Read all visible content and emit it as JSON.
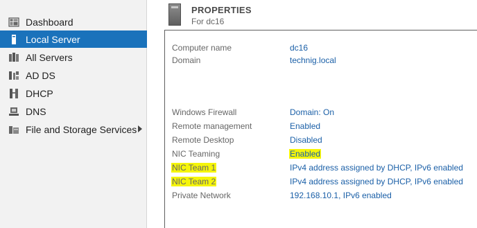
{
  "sidebar": {
    "items": [
      {
        "label": "Dashboard",
        "icon": "dashboard-icon"
      },
      {
        "label": "Local Server",
        "icon": "server-icon",
        "active": true
      },
      {
        "label": "All Servers",
        "icon": "all-servers-icon"
      },
      {
        "label": "AD DS",
        "icon": "ad-ds-icon"
      },
      {
        "label": "DHCP",
        "icon": "dhcp-icon"
      },
      {
        "label": "DNS",
        "icon": "dns-icon"
      },
      {
        "label": "File and Storage Services",
        "icon": "file-storage-icon",
        "has_submenu": true
      }
    ]
  },
  "properties": {
    "title": "PROPERTIES",
    "subtitle": "For dc16",
    "rows": [
      {
        "label": "Computer name",
        "value": "dc16"
      },
      {
        "label": "Domain",
        "value": "technig.local"
      },
      {
        "label": "Windows Firewall",
        "value": "Domain: On"
      },
      {
        "label": "Remote management",
        "value": "Enabled"
      },
      {
        "label": "Remote Desktop",
        "value": "Disabled"
      },
      {
        "label": "NIC Teaming",
        "value": "Enabled"
      },
      {
        "label": "NIC Team 1",
        "value": "IPv4 address assigned by DHCP, IPv6 enabled"
      },
      {
        "label": "NIC Team 2",
        "value": "IPv4 address assigned by DHCP, IPv6 enabled"
      },
      {
        "label": "Private Network",
        "value": "192.168.10.1, IPv6 enabled"
      }
    ]
  },
  "colors": {
    "accent": "#1a72bb",
    "link": "#1a5fa7",
    "highlight": "#f5f50a"
  }
}
